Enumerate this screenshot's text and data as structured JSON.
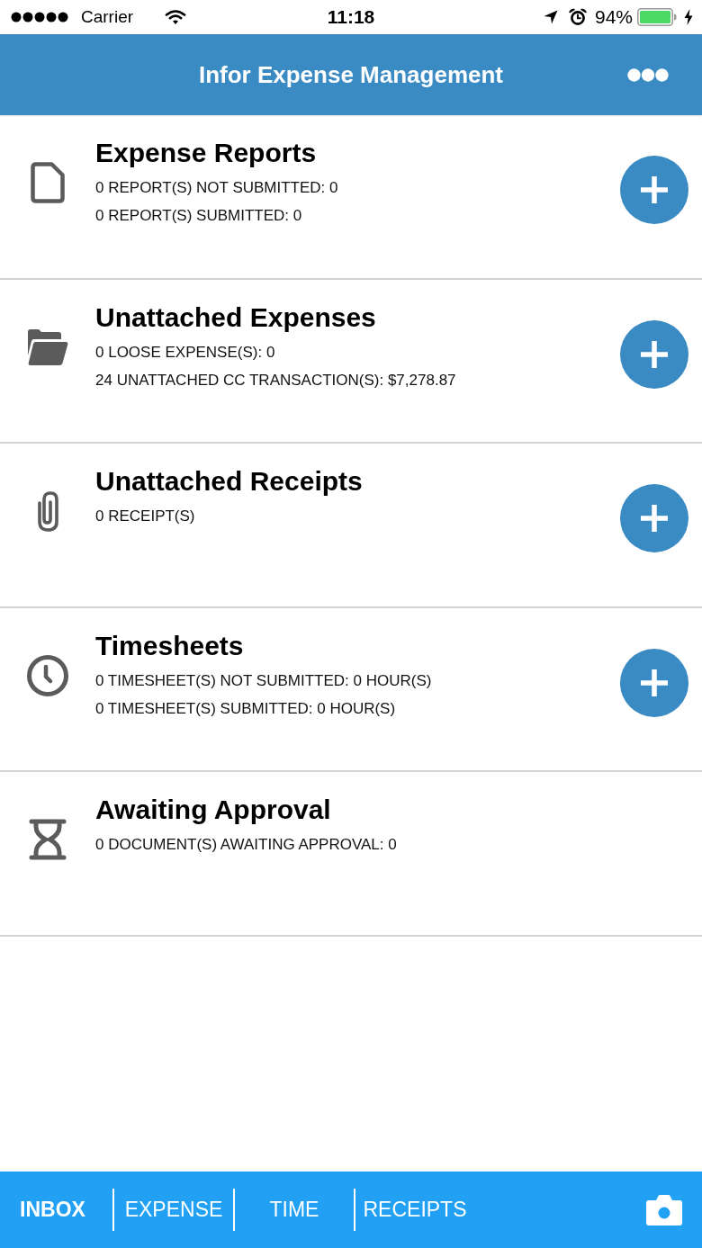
{
  "status_bar": {
    "carrier": "Carrier",
    "time": "11:18",
    "battery": "94%"
  },
  "header": {
    "title": "Infor Expense Management"
  },
  "sections": [
    {
      "title": "Expense Reports",
      "lines": [
        "0 REPORT(S) NOT SUBMITTED: 0",
        "0 REPORT(S) SUBMITTED: 0"
      ],
      "add_button": true
    },
    {
      "title": "Unattached Expenses",
      "lines": [
        "0 LOOSE EXPENSE(S): 0",
        "24 UNATTACHED CC TRANSACTION(S): $7,278.87"
      ],
      "add_button": true
    },
    {
      "title": "Unattached Receipts",
      "lines": [
        "0 RECEIPT(S)"
      ],
      "add_button": true
    },
    {
      "title": "Timesheets",
      "lines": [
        "0 TIMESHEET(S) NOT SUBMITTED: 0 HOUR(S)",
        "0 TIMESHEET(S) SUBMITTED: 0 HOUR(S)"
      ],
      "add_button": true
    },
    {
      "title": "Awaiting Approval",
      "lines": [
        "0 DOCUMENT(S) AWAITING APPROVAL: 0"
      ],
      "add_button": false
    }
  ],
  "tab_bar": {
    "tabs": [
      {
        "label": "INBOX",
        "selected": true
      },
      {
        "label": "EXPENSE",
        "selected": false
      },
      {
        "label": "TIME",
        "selected": false
      },
      {
        "label": "RECEIPTS",
        "selected": false
      }
    ]
  }
}
